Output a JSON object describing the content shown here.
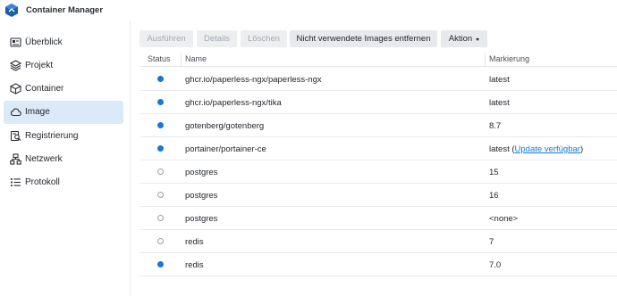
{
  "app": {
    "title": "Container Manager"
  },
  "sidebar": {
    "items": [
      {
        "label": "Überblick",
        "icon": "overview-icon"
      },
      {
        "label": "Projekt",
        "icon": "project-icon"
      },
      {
        "label": "Container",
        "icon": "container-icon"
      },
      {
        "label": "Image",
        "icon": "cloud-icon",
        "active": true
      },
      {
        "label": "Registrierung",
        "icon": "registry-icon"
      },
      {
        "label": "Netzwerk",
        "icon": "network-icon"
      },
      {
        "label": "Protokoll",
        "icon": "log-icon"
      }
    ]
  },
  "toolbar": {
    "run_label": "Ausführen",
    "details_label": "Details",
    "delete_label": "Löschen",
    "remove_unused_label": "Nicht verwendete Images entfernen",
    "action_label": "Aktion"
  },
  "table": {
    "columns": {
      "status": "Status",
      "name": "Name",
      "tag": "Markierung"
    },
    "rows": [
      {
        "status": "running",
        "name": "ghcr.io/paperless-ngx/paperless-ngx",
        "tag": "latest"
      },
      {
        "status": "running",
        "name": "ghcr.io/paperless-ngx/tika",
        "tag": "latest"
      },
      {
        "status": "running",
        "name": "gotenberg/gotenberg",
        "tag": "8.7"
      },
      {
        "status": "running",
        "name": "portainer/portainer-ce",
        "tag": "latest",
        "tag_prefix": "latest (",
        "tag_link": "Update verfügbar",
        "tag_suffix": ")"
      },
      {
        "status": "stopped",
        "name": "postgres",
        "tag": "15"
      },
      {
        "status": "stopped",
        "name": "postgres",
        "tag": "16"
      },
      {
        "status": "stopped",
        "name": "postgres",
        "tag": "<none>"
      },
      {
        "status": "stopped",
        "name": "redis",
        "tag": "7"
      },
      {
        "status": "running",
        "name": "redis",
        "tag": "7.0"
      }
    ]
  },
  "colors": {
    "accent": "#1677d7",
    "active_nav_bg": "#dbeaf9",
    "stopped_dot": "#9aa0a6"
  }
}
